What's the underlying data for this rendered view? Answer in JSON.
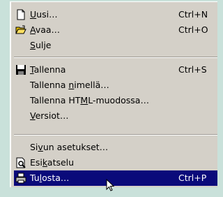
{
  "menu": {
    "items": [
      {
        "pre": "",
        "acc": "U",
        "post": "usi…",
        "shortcut": "Ctrl+N",
        "icon": "new-document-icon"
      },
      {
        "pre": "",
        "acc": "A",
        "post": "vaa…",
        "shortcut": "Ctrl+O",
        "icon": "open-folder-icon"
      },
      {
        "pre": "",
        "acc": "S",
        "post": "ulje",
        "shortcut": "",
        "icon": ""
      },
      {
        "pre": "",
        "acc": "T",
        "post": "allenna",
        "shortcut": "Ctrl+S",
        "icon": "save-disk-icon"
      },
      {
        "pre": "Tallenna ",
        "acc": "n",
        "post": "imellä…",
        "shortcut": "",
        "icon": ""
      },
      {
        "pre": "Tallenna HT",
        "acc": "M",
        "post": "L-muodossa…",
        "shortcut": "",
        "icon": ""
      },
      {
        "pre": "",
        "acc": "V",
        "post": "ersiot…",
        "shortcut": "",
        "icon": ""
      },
      {
        "pre": "Si",
        "acc": "v",
        "post": "un asetukset…",
        "shortcut": "",
        "icon": ""
      },
      {
        "pre": "Esi",
        "acc": "k",
        "post": "atselu",
        "shortcut": "",
        "icon": "print-preview-icon"
      },
      {
        "pre": "Tu",
        "acc": "l",
        "post": "osta…",
        "shortcut": "Ctrl+P",
        "icon": "printer-icon",
        "selected": true
      }
    ]
  },
  "colors": {
    "background": "#c9e1da",
    "menu": "#d4d0c8",
    "highlight": "#0a0a7a"
  }
}
